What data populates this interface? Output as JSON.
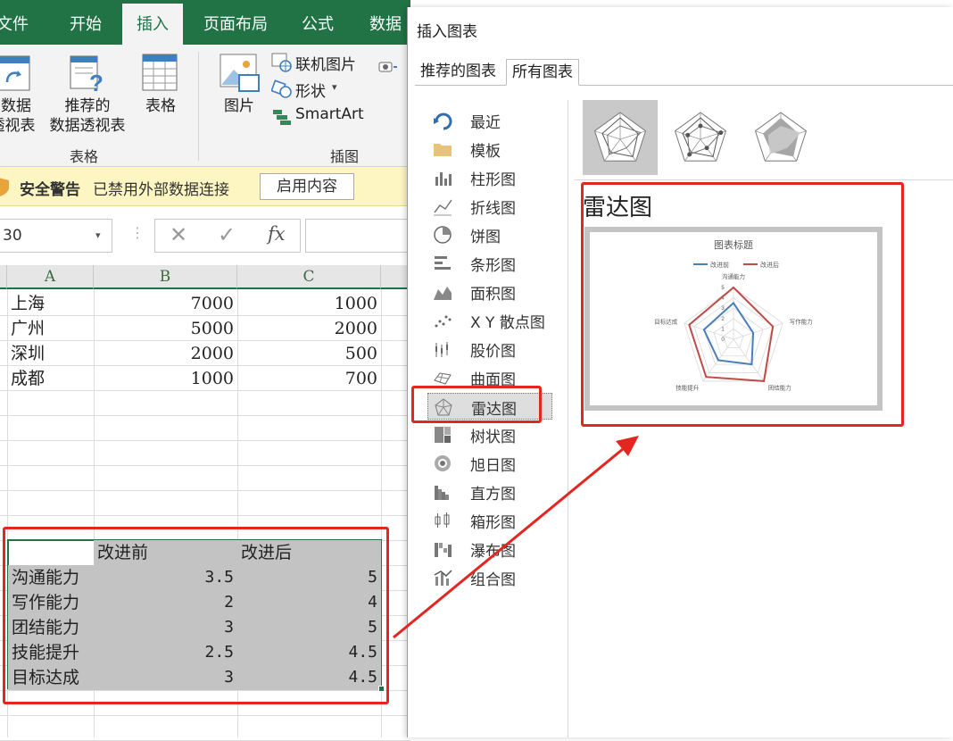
{
  "ribbon": {
    "tabs": [
      {
        "label": "文件"
      },
      {
        "label": "开始"
      },
      {
        "label": "插入"
      },
      {
        "label": "页面布局"
      },
      {
        "label": "公式"
      },
      {
        "label": "数据"
      }
    ],
    "pivot_line1": "数据",
    "pivot_line2": "透视表",
    "rec_pivot_line1": "推荐的",
    "rec_pivot_line2": "数据透视表",
    "table_label": "表格",
    "group_tables": "表格",
    "picture_label": "图片",
    "online_picture": "联机图片",
    "shapes": "形状",
    "smartart": "SmartArt",
    "group_illustrations": "插图"
  },
  "security": {
    "title": "安全警告",
    "message": "已禁用外部数据连接",
    "button": "启用内容"
  },
  "formula_bar": {
    "name_box": "30",
    "fx": "fx"
  },
  "sheet": {
    "columns": [
      "A",
      "B",
      "C"
    ],
    "top_rows": [
      {
        "a": "上海",
        "b": "7000",
        "c": "1000"
      },
      {
        "a": "广州",
        "b": "5000",
        "c": "2000"
      },
      {
        "a": "深圳",
        "b": "2000",
        "c": "500"
      },
      {
        "a": "成都",
        "b": "1000",
        "c": "700"
      }
    ],
    "radar_header": {
      "a": "",
      "b": "改进前",
      "c": "改进后"
    },
    "radar_rows": [
      {
        "a": "沟通能力",
        "b": "3.5",
        "c": "5"
      },
      {
        "a": "写作能力",
        "b": "2",
        "c": "4"
      },
      {
        "a": "团结能力",
        "b": "3",
        "c": "5"
      },
      {
        "a": "技能提升",
        "b": "2.5",
        "c": "4.5"
      },
      {
        "a": "目标达成",
        "b": "3",
        "c": "4.5"
      }
    ]
  },
  "dialog": {
    "title": "插入图表",
    "tabs": [
      {
        "label": "推荐的图表"
      },
      {
        "label": "所有图表"
      }
    ],
    "types": [
      {
        "label": "最近",
        "icon": "recent-icon"
      },
      {
        "label": "模板",
        "icon": "folder-icon"
      },
      {
        "label": "柱形图",
        "icon": "column-chart-icon"
      },
      {
        "label": "折线图",
        "icon": "line-chart-icon"
      },
      {
        "label": "饼图",
        "icon": "pie-chart-icon"
      },
      {
        "label": "条形图",
        "icon": "bar-chart-icon"
      },
      {
        "label": "面积图",
        "icon": "area-chart-icon"
      },
      {
        "label": "X Y 散点图",
        "icon": "scatter-chart-icon"
      },
      {
        "label": "股价图",
        "icon": "stock-chart-icon"
      },
      {
        "label": "曲面图",
        "icon": "surface-chart-icon"
      },
      {
        "label": "雷达图",
        "icon": "radar-chart-icon"
      },
      {
        "label": "树状图",
        "icon": "treemap-icon"
      },
      {
        "label": "旭日图",
        "icon": "sunburst-icon"
      },
      {
        "label": "直方图",
        "icon": "histogram-icon"
      },
      {
        "label": "箱形图",
        "icon": "box-whisker-icon"
      },
      {
        "label": "瀑布图",
        "icon": "waterfall-icon"
      },
      {
        "label": "组合图",
        "icon": "combo-chart-icon"
      }
    ],
    "selected_type": "雷达图",
    "chart_name": "雷达图"
  },
  "colors": {
    "excel_green": "#217346",
    "highlight_red": "#e3261f",
    "series_before": "#4a7ebb",
    "series_after": "#be4b48"
  },
  "chart_data": {
    "type": "radar",
    "title": "图表标题",
    "categories": [
      "沟通能力",
      "写作能力",
      "团结能力",
      "技能提升",
      "目标达成"
    ],
    "series": [
      {
        "name": "改进前",
        "values": [
          3.5,
          2,
          3,
          2.5,
          3
        ]
      },
      {
        "name": "改进后",
        "values": [
          5,
          4,
          5,
          4.5,
          4.5
        ]
      }
    ],
    "rlim": [
      0,
      5
    ],
    "ticks": [
      "0",
      "1",
      "2",
      "3",
      "4",
      "5"
    ],
    "legend_position": "top"
  }
}
